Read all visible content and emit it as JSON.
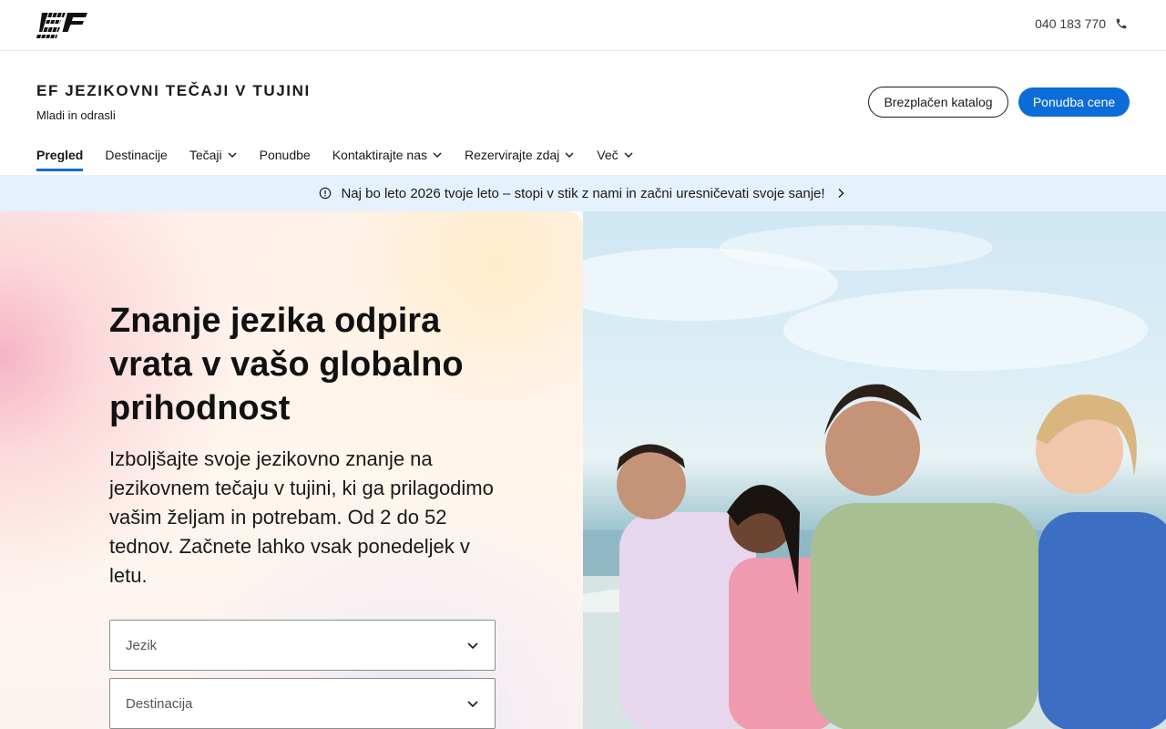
{
  "header": {
    "phone": "040 183 770",
    "brand_title": "EF JEZIKOVNI TEČAJI V TUJINI",
    "brand_subtitle": "Mladi in odrasli",
    "catalog_button": "Brezplačen katalog",
    "quote_button": "Ponudba cene"
  },
  "nav": {
    "items": [
      {
        "label": "Pregled",
        "active": true
      },
      {
        "label": "Destinacije"
      },
      {
        "label": "Tečaji",
        "dropdown": true
      },
      {
        "label": "Ponudbe"
      },
      {
        "label": "Kontaktirajte nas",
        "dropdown": true
      },
      {
        "label": "Rezervirajte zdaj",
        "dropdown": true
      },
      {
        "label": "Več",
        "dropdown": true
      }
    ]
  },
  "banner": {
    "text": "Naj bo leto 2026 tvoje leto – stopi v stik z nami in začni uresničevati svoje sanje!"
  },
  "hero": {
    "headline": "Znanje jezika odpira vrata v vašo globalno prihodnost",
    "lead": "Izboljšajte svoje jezikovno znanje na jezikovnem tečaju v tujini, ki ga prilagodimo vašim željam in potrebam. Od 2 do 52 tednov. Začnete lahko vsak ponedeljek v letu.",
    "selects": [
      {
        "placeholder": "Jezik"
      },
      {
        "placeholder": "Destinacija"
      }
    ]
  },
  "colors": {
    "accent": "#0c6cd8",
    "banner_bg": "#e5f1fd"
  },
  "icons": [
    "ef-logo",
    "phone-icon",
    "chevron-down-icon",
    "info-icon",
    "chevron-right-icon"
  ]
}
